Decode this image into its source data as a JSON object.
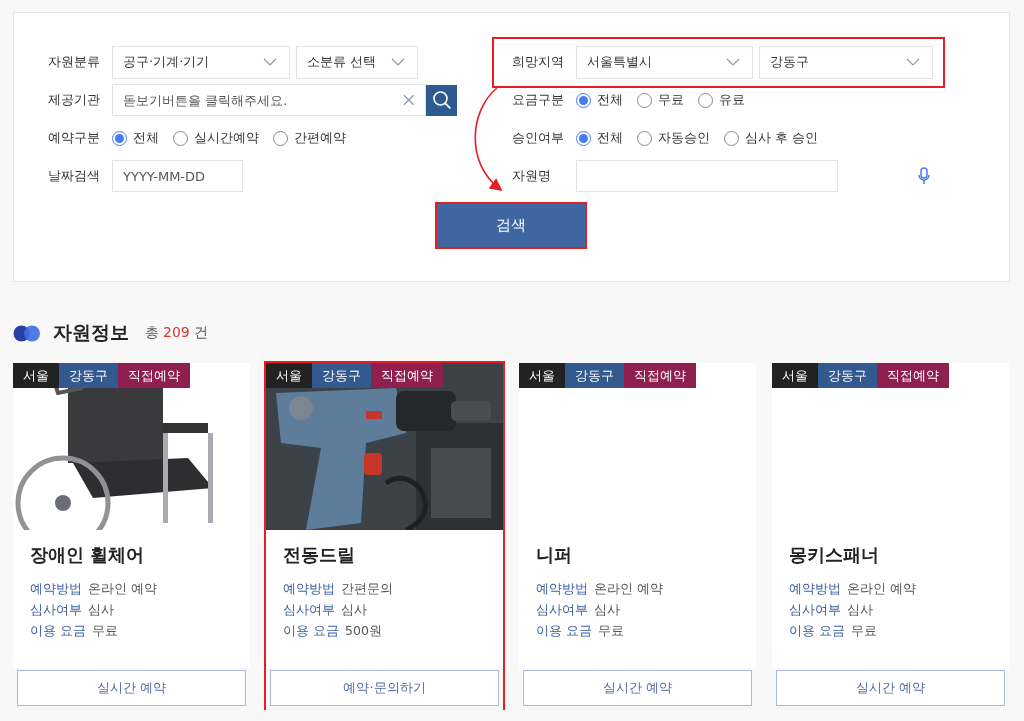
{
  "search_panel": {
    "left_fields": [
      {
        "kind": "selects",
        "label": "자원분류",
        "selects": [
          {
            "value": "공구·기계·기기"
          },
          {
            "value": "소분류 선택"
          }
        ]
      },
      {
        "kind": "lookup",
        "label": "제공기관",
        "placeholder": "돋보기버튼을 클릭해주세요."
      },
      {
        "kind": "radios",
        "label": "예약구분",
        "options": [
          {
            "label": "전체",
            "selected": true
          },
          {
            "label": "실시간예약",
            "selected": false
          },
          {
            "label": "간편예약",
            "selected": false
          }
        ]
      },
      {
        "kind": "date",
        "label": "날짜검색",
        "placeholder": "YYYY-MM-DD"
      }
    ],
    "right_fields": [
      {
        "kind": "selects",
        "label": "희망지역",
        "highlighted": true,
        "selects": [
          {
            "value": "서울특별시"
          },
          {
            "value": "강동구"
          }
        ]
      },
      {
        "kind": "radios",
        "label": "요금구분",
        "options": [
          {
            "label": "전체",
            "selected": true
          },
          {
            "label": "무료",
            "selected": false
          },
          {
            "label": "유료",
            "selected": false
          }
        ]
      },
      {
        "kind": "radios",
        "label": "승인여부",
        "options": [
          {
            "label": "전체",
            "selected": true
          },
          {
            "label": "자동승인",
            "selected": false
          },
          {
            "label": "심사 후 승인",
            "selected": false
          }
        ]
      },
      {
        "kind": "text",
        "label": "자원명"
      }
    ],
    "search_button": {
      "label": "검색",
      "highlighted": true
    }
  },
  "results": {
    "title": "자원정보",
    "count_prefix": "총",
    "count": "209",
    "count_suffix": "건",
    "cards": [
      {
        "tags": [
          {
            "label": "서울",
            "color": "#222222"
          },
          {
            "label": "강동구",
            "color": "#335a8f"
          },
          {
            "label": "직접예약",
            "color": "#8e1f4f"
          }
        ],
        "image": {
          "kind": "picture"
        },
        "title": "장애인 휠체어",
        "details": [
          {
            "label": "예약방법",
            "value": "온라인 예약"
          },
          {
            "label": "심사여부",
            "value": "심사"
          },
          {
            "label": "이용 요금",
            "value": "무료"
          }
        ],
        "button": "실시간 예약",
        "highlighted": false
      },
      {
        "tags": [
          {
            "label": "서울",
            "color": "#222222"
          },
          {
            "label": "강동구",
            "color": "#335a8f"
          },
          {
            "label": "직접예약",
            "color": "#8e1f4f"
          }
        ],
        "image": {
          "kind": "picture"
        },
        "title": "전동드릴",
        "details": [
          {
            "label": "예약방법",
            "value": "간편문의"
          },
          {
            "label": "심사여부",
            "value": "심사"
          },
          {
            "label": "이용 요금",
            "value": "500원"
          }
        ],
        "button": "예약·문의하기",
        "highlighted": true
      },
      {
        "tags": [
          {
            "label": "서울",
            "color": "#222222"
          },
          {
            "label": "강동구",
            "color": "#335a8f"
          },
          {
            "label": "직접예약",
            "color": "#8e1f4f"
          }
        ],
        "title": "니퍼",
        "details": [
          {
            "label": "예약방법",
            "value": "온라인 예약"
          },
          {
            "label": "심사여부",
            "value": "심사"
          },
          {
            "label": "이용 요금",
            "value": "무료"
          }
        ],
        "button": "실시간 예약",
        "highlighted": false
      },
      {
        "tags": [
          {
            "label": "서울",
            "color": "#222222"
          },
          {
            "label": "강동구",
            "color": "#335a8f"
          },
          {
            "label": "직접예약",
            "color": "#8e1f4f"
          }
        ],
        "title": "몽키스패너",
        "details": [
          {
            "label": "예약방법",
            "value": "온라인 예약"
          },
          {
            "label": "심사여부",
            "value": "심사"
          },
          {
            "label": "이용 요금",
            "value": "무료"
          }
        ],
        "button": "실시간 예약",
        "highlighted": false
      }
    ]
  }
}
